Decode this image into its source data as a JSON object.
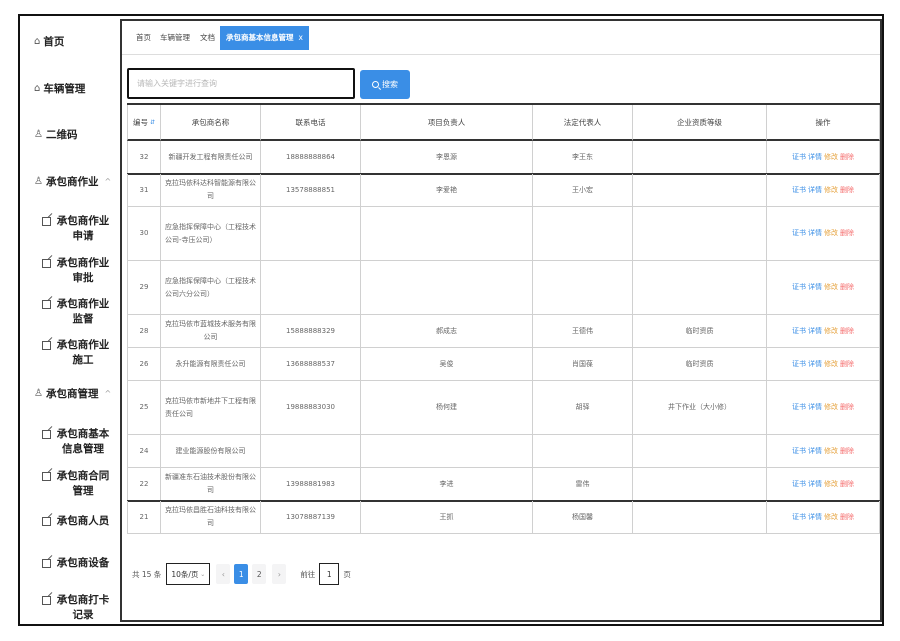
{
  "sidebar": {
    "home": "首页",
    "vehicle": "车辆管理",
    "qrcode": "二维码",
    "work_group": "承包商作业",
    "work_items": [
      "承包商作业申请",
      "承包商作业审批",
      "承包商作业监督",
      "承包商作业施工"
    ],
    "mgmt_group": "承包商管理",
    "mgmt_items": [
      "承包商基本信息管理",
      "承包商合同管理",
      "承包商人员",
      "承包商设备",
      "承包商打卡记录"
    ]
  },
  "tabs": [
    {
      "label": "首页"
    },
    {
      "label": "车辆管理"
    },
    {
      "label": "文档"
    },
    {
      "label": "承包商基本信息管理",
      "active": true,
      "close": "x"
    }
  ],
  "search": {
    "placeholder": "请输入关键字进行查询",
    "button": "搜索"
  },
  "table": {
    "headers": [
      "编号",
      "承包商名称",
      "联系电话",
      "项目负责人",
      "法定代表人",
      "企业资质等级",
      "操作"
    ],
    "ops": [
      "证书",
      "详情",
      "修改",
      "删除"
    ],
    "rows": [
      {
        "id": "32",
        "name": "新疆开发工程有限责任公司",
        "phone": "18888888864",
        "manager": "李恩源",
        "legal": "李王东",
        "level": ""
      },
      {
        "id": "31",
        "name": "克拉玛依科达科智能源有限公司",
        "phone": "13578888851",
        "manager": "李爱艳",
        "legal": "王小宏",
        "level": ""
      },
      {
        "id": "30",
        "name": "应急指挥保障中心（工程技术公司-寺压公司）",
        "phone": "",
        "manager": "",
        "legal": "",
        "level": ""
      },
      {
        "id": "29",
        "name": "应急指挥保障中心（工程技术公司六分公司）",
        "phone": "",
        "manager": "",
        "legal": "",
        "level": ""
      },
      {
        "id": "28",
        "name": "克拉玛依市蓝城技术服务有限公司",
        "phone": "15888888329",
        "manager": "郝成志",
        "legal": "王德伟",
        "level": "临时资质"
      },
      {
        "id": "26",
        "name": "永升能源有限责任公司",
        "phone": "13688888537",
        "manager": "吴俊",
        "legal": "肖国葆",
        "level": "临时资质"
      },
      {
        "id": "25",
        "name": "克拉玛依市新地井下工程有限责任公司",
        "phone": "19888883030",
        "manager": "杨何建",
        "legal": "胡驿",
        "level": "井下作业（大小修）"
      },
      {
        "id": "24",
        "name": "建业能源股份有限公司",
        "phone": "",
        "manager": "",
        "legal": "",
        "level": ""
      },
      {
        "id": "22",
        "name": "新疆准东石油技术股份有限公司",
        "phone": "13988881983",
        "manager": "李进",
        "legal": "雷伟",
        "level": ""
      },
      {
        "id": "21",
        "name": "克拉玛依昌胜石油科技有限公司",
        "phone": "13078887139",
        "manager": "王抓",
        "legal": "杨国馨",
        "level": ""
      }
    ]
  },
  "pager": {
    "total": "共 15 条",
    "size": "10条/页",
    "prev": "‹",
    "pages": [
      "1",
      "2"
    ],
    "next": "›",
    "goto": "前往",
    "input": "1",
    "unit": "页"
  }
}
